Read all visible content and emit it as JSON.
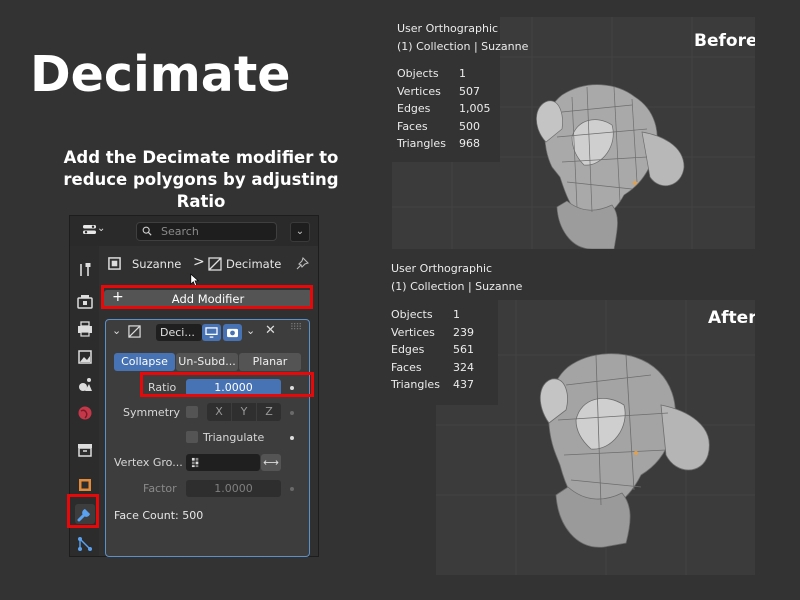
{
  "title": "Decimate",
  "subtitle": "Add the Decimate modifier to reduce polygons by adjusting Ratio",
  "panel": {
    "search_placeholder": "Search",
    "breadcrumb": {
      "object": "Suzanne",
      "separator": ">",
      "modifier": "Decimate"
    },
    "add_modifier_label": "Add Modifier",
    "modifier": {
      "name": "Deci...",
      "modes": [
        "Collapse",
        "Un-Subd...",
        "Planar"
      ],
      "ratio_label": "Ratio",
      "ratio_value": "1.0000",
      "ratio_fraction": 1.0,
      "symmetry_label": "Symmetry",
      "axes": [
        "X",
        "Y",
        "Z"
      ],
      "triangulate_label": "Triangulate",
      "vertex_group_label": "Vertex Gro...",
      "factor_label": "Factor",
      "factor_value": "1.0000",
      "face_count": "Face Count: 500"
    },
    "tabs": [
      "tool",
      "render",
      "output",
      "view-layer",
      "scene",
      "world",
      "collection",
      "object",
      "modifiers",
      "particles"
    ],
    "active_tab": "modifiers"
  },
  "before": {
    "tag": "Before",
    "view": "User Orthographic",
    "collection": "(1) Collection | Suzanne",
    "stats": [
      {
        "label": "Objects",
        "value": "1"
      },
      {
        "label": "Vertices",
        "value": "507"
      },
      {
        "label": "Edges",
        "value": "1,005"
      },
      {
        "label": "Faces",
        "value": "500"
      },
      {
        "label": "Triangles",
        "value": "968"
      }
    ]
  },
  "after": {
    "tag": "After",
    "view": "User Orthographic",
    "collection": "(1) Collection | Suzanne",
    "stats": [
      {
        "label": "Objects",
        "value": "1"
      },
      {
        "label": "Vertices",
        "value": "239"
      },
      {
        "label": "Edges",
        "value": "561"
      },
      {
        "label": "Faces",
        "value": "324"
      },
      {
        "label": "Triangles",
        "value": "437"
      }
    ]
  },
  "colors": {
    "background": "#333333",
    "highlight": "#e8080a",
    "accent": "#4772b3"
  }
}
